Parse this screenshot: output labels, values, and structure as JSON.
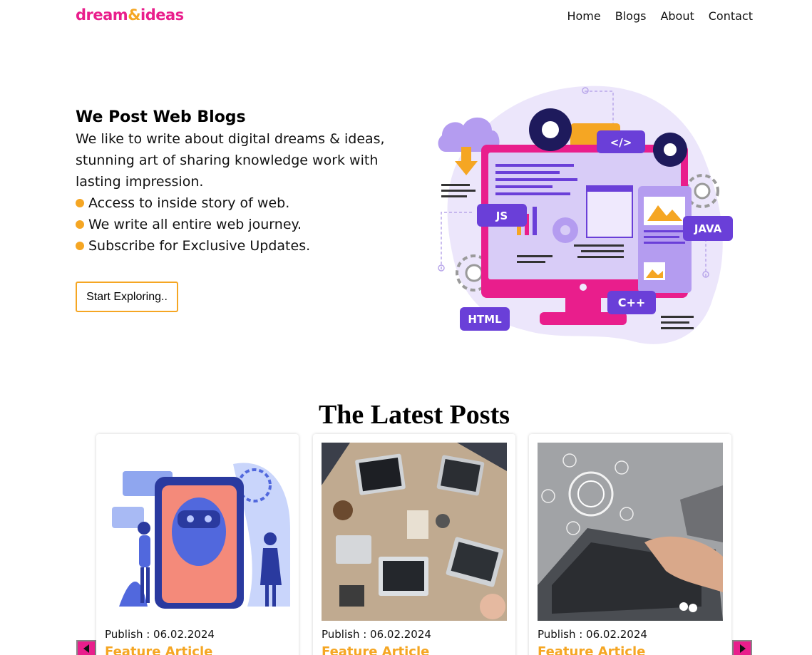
{
  "header": {
    "logo": {
      "part1": "dream",
      "amp": "&",
      "part2": "ideas"
    },
    "nav": [
      {
        "label": "Home"
      },
      {
        "label": "Blogs"
      },
      {
        "label": "About"
      },
      {
        "label": "Contact"
      }
    ]
  },
  "hero": {
    "title": "We Post Web Blogs",
    "description": "We like to write about digital dreams & ideas, stunning art of sharing knowledge work with lasting impression.",
    "bullets": [
      "Access to inside story of web.",
      "We write all entire web journey.",
      "Subscribe for Exclusive Updates."
    ],
    "cta_label": "Start Exploring..",
    "illustration": {
      "badges": [
        "</>",
        "JS",
        "JAVA",
        "C++",
        "HTML"
      ]
    }
  },
  "latest": {
    "title": "The Latest Posts",
    "posts": [
      {
        "publish": "Publish : 06.02.2024",
        "tag": "Feature Article"
      },
      {
        "publish": "Publish : 06.02.2024",
        "tag": "Feature Article"
      },
      {
        "publish": "Publish : 06.02.2024",
        "tag": "Feature Article"
      }
    ],
    "prev_icon": "caret-left-icon",
    "next_icon": "caret-right-icon"
  },
  "colors": {
    "brand_pink": "#e91e8c",
    "accent_orange": "#f5a623",
    "illustration_purple": "#6a3fd8"
  }
}
